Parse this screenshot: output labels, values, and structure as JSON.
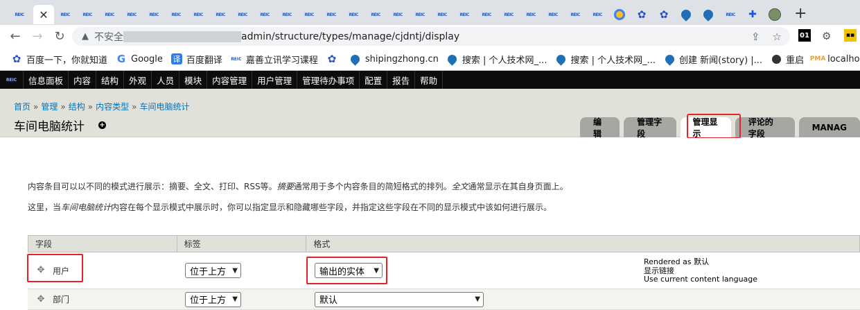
{
  "browser": {
    "tabs": [
      {
        "kind": "reic",
        "label": "REIC"
      },
      {
        "kind": "close",
        "label": "✕"
      },
      {
        "kind": "reic",
        "label": "REIC"
      },
      {
        "kind": "reic",
        "label": "REIC"
      },
      {
        "kind": "reic",
        "label": "REIC"
      },
      {
        "kind": "reic",
        "label": "REIC"
      },
      {
        "kind": "reic",
        "label": "REIC"
      },
      {
        "kind": "reic",
        "label": "REIC"
      },
      {
        "kind": "reic",
        "label": "REIC"
      },
      {
        "kind": "reic",
        "label": "REIC"
      },
      {
        "kind": "reic",
        "label": "REIC"
      },
      {
        "kind": "reic",
        "label": "REIC"
      },
      {
        "kind": "reic",
        "label": "REIC"
      },
      {
        "kind": "reic",
        "label": "REIC"
      },
      {
        "kind": "reic",
        "label": "REIC"
      },
      {
        "kind": "reic",
        "label": "REIC"
      },
      {
        "kind": "reic",
        "label": "REIC"
      },
      {
        "kind": "reic",
        "label": "REIC"
      },
      {
        "kind": "reic",
        "label": "REIC"
      },
      {
        "kind": "reic",
        "label": "REIC"
      },
      {
        "kind": "reic",
        "label": "REIC"
      },
      {
        "kind": "reic",
        "label": "REIC"
      },
      {
        "kind": "reic",
        "label": "REIC"
      },
      {
        "kind": "reic",
        "label": "REIC"
      },
      {
        "kind": "reic",
        "label": "REIC"
      },
      {
        "kind": "reic",
        "label": "REIC"
      },
      {
        "kind": "reic",
        "label": "REIC"
      },
      {
        "kind": "circle"
      },
      {
        "kind": "paw"
      },
      {
        "kind": "paw"
      },
      {
        "kind": "drop"
      },
      {
        "kind": "drop"
      },
      {
        "kind": "reic",
        "label": "REIC"
      },
      {
        "kind": "puzzle"
      },
      {
        "kind": "avatar"
      }
    ],
    "new_tab": "+",
    "nav": {
      "back": "←",
      "forward": "→",
      "reload": "↻"
    },
    "address": {
      "warning_icon": "▲",
      "insecure": "不安全",
      "url": "admin/structure/types/manage/cjdntj/display",
      "share_icon": "⇪",
      "star_icon": "☆"
    },
    "extensions": {
      "ext1": "01",
      "ext2": "⚙",
      "ext3": "▪▪"
    },
    "bookmarks": [
      {
        "icon": "paw",
        "label": "百度一下，你就知道"
      },
      {
        "icon": "google",
        "glyph": "G",
        "label": "Google"
      },
      {
        "icon": "fanyi",
        "glyph": "译",
        "label": "百度翻译"
      },
      {
        "icon": "reic",
        "glyph": "REIC",
        "label": "嘉善立讯学习课程"
      },
      {
        "icon": "paw",
        "label": ""
      },
      {
        "icon": "drop",
        "label": "shipingzhong.cn"
      },
      {
        "icon": "drop",
        "label": "搜索 | 个人技术网_..."
      },
      {
        "icon": "drop",
        "label": "搜索 | 个人技术网_..."
      },
      {
        "icon": "drop",
        "label": "创建 新闻(story) |..."
      },
      {
        "icon": "restart",
        "label": "重启"
      },
      {
        "icon": "pma",
        "glyph": "PMA",
        "label": "localhost php"
      }
    ]
  },
  "admin_toolbar": {
    "home": "REIC",
    "items": [
      "信息面板",
      "内容",
      "结构",
      "外观",
      "人员",
      "模块",
      "内容管理",
      "用户管理",
      "管理待办事项",
      "配置",
      "报告",
      "帮助"
    ]
  },
  "header": {
    "breadcrumb": [
      "首页",
      "管理",
      "结构",
      "内容类型",
      "车间电脑统计"
    ],
    "breadcrumb_sep": "»",
    "title": "车间电脑统计",
    "shortcut": "+",
    "tabs": [
      {
        "label": "编辑",
        "active": false
      },
      {
        "label": "管理字段",
        "active": false
      },
      {
        "label": "管理显示",
        "active": true
      },
      {
        "label": "评论的字段",
        "active": false
      },
      {
        "label": "MANAG",
        "active": false
      }
    ]
  },
  "intro": {
    "p1_a": "内容条目可以以不同的模式进行展示：摘要、全文、打印、RSS等。",
    "p1_em1": "摘要",
    "p1_b": "通常用于多个内容条目的简短格式的排列。",
    "p1_em2": "全文",
    "p1_c": "通常显示在其自身页面上。",
    "p2_a": "这里，当",
    "p2_em": "车间电脑统计",
    "p2_b": "内容在每个显示模式中展示时，你可以指定显示和隐藏哪些字段，并指定这些字段在不同的显示模式中该如何进行展示。"
  },
  "table": {
    "headers": {
      "field": "字段",
      "label": "标签",
      "format": "格式"
    },
    "drag_icon": "✥",
    "rows": [
      {
        "field": "用户",
        "label_select": "位于上方",
        "format_select": "输出的实体",
        "summary": [
          "Rendered as 默认",
          "显示链接",
          "Use current content language"
        ]
      },
      {
        "field": "部门",
        "label_select": "位于上方",
        "format_select": "默认",
        "summary": []
      }
    ]
  }
}
